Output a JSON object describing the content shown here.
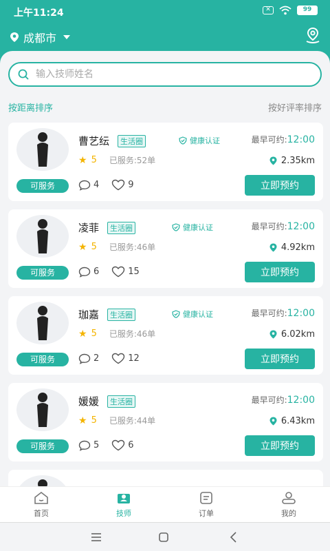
{
  "status_bar": {
    "time": "上午11:24",
    "battery": "99"
  },
  "header": {
    "city": "成都市"
  },
  "search": {
    "placeholder": "输入技师姓名"
  },
  "sort": {
    "left": "按距离排序",
    "right": "按好评率排序"
  },
  "colors": {
    "accent": "#27b3a2",
    "star": "#f4b400"
  },
  "cards": [
    {
      "name": "曹艺纭",
      "tag": "生活圈",
      "health": "健康认证",
      "earliest_label": "最早可约:",
      "earliest_time": "12:00",
      "score": "5",
      "served": "已服务:52单",
      "distance": "2.35km",
      "status": "可服务",
      "comments": "4",
      "likes": "9",
      "book": "立即预约"
    },
    {
      "name": "凌菲",
      "tag": "生活圈",
      "health": "健康认证",
      "earliest_label": "最早可约:",
      "earliest_time": "12:00",
      "score": "5",
      "served": "已服务:46单",
      "distance": "4.92km",
      "status": "可服务",
      "comments": "6",
      "likes": "15",
      "book": "立即预约"
    },
    {
      "name": "珈嘉",
      "tag": "生活圈",
      "health": "健康认证",
      "earliest_label": "最早可约:",
      "earliest_time": "12:00",
      "score": "5",
      "served": "已服务:46单",
      "distance": "6.02km",
      "status": "可服务",
      "comments": "2",
      "likes": "12",
      "book": "立即预约"
    },
    {
      "name": "媛媛",
      "tag": "生活圈",
      "earliest_label": "最早可约:",
      "earliest_time": "12:00",
      "score": "5",
      "served": "已服务:44单",
      "distance": "6.43km",
      "status": "可服务",
      "comments": "5",
      "likes": "6",
      "book": "立即预约"
    }
  ],
  "tabs": [
    {
      "label": "首页",
      "icon": "home-icon"
    },
    {
      "label": "技师",
      "icon": "technician-icon"
    },
    {
      "label": "订单",
      "icon": "order-icon"
    },
    {
      "label": "我的",
      "icon": "profile-icon"
    }
  ]
}
